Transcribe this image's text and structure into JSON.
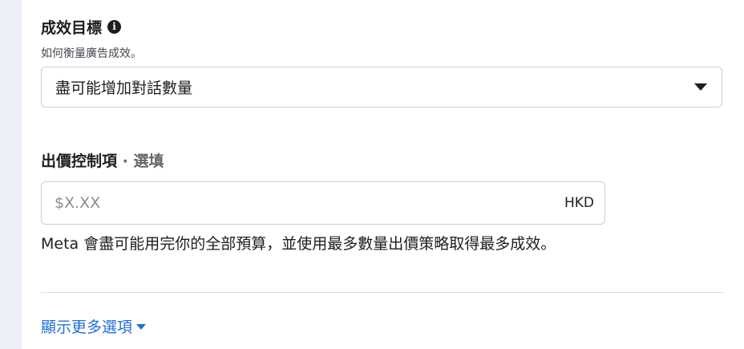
{
  "performance_goal": {
    "title": "成效目標",
    "info_icon": "info-icon",
    "subtitle": "如何衡量廣告成效。",
    "selected": "盡可能增加對話數量"
  },
  "bid_control": {
    "title": "出價控制項",
    "optional": "· 選填",
    "placeholder": "$X.XX",
    "currency": "HKD",
    "note": "Meta 會盡可能用完你的全部預算，並使用最多數量出價策略取得最多成效。"
  },
  "more_options": {
    "label": "顯示更多選項"
  },
  "colors": {
    "link": "#216fdb",
    "page_bg": "#eceef8",
    "text": "#1c1e21"
  }
}
